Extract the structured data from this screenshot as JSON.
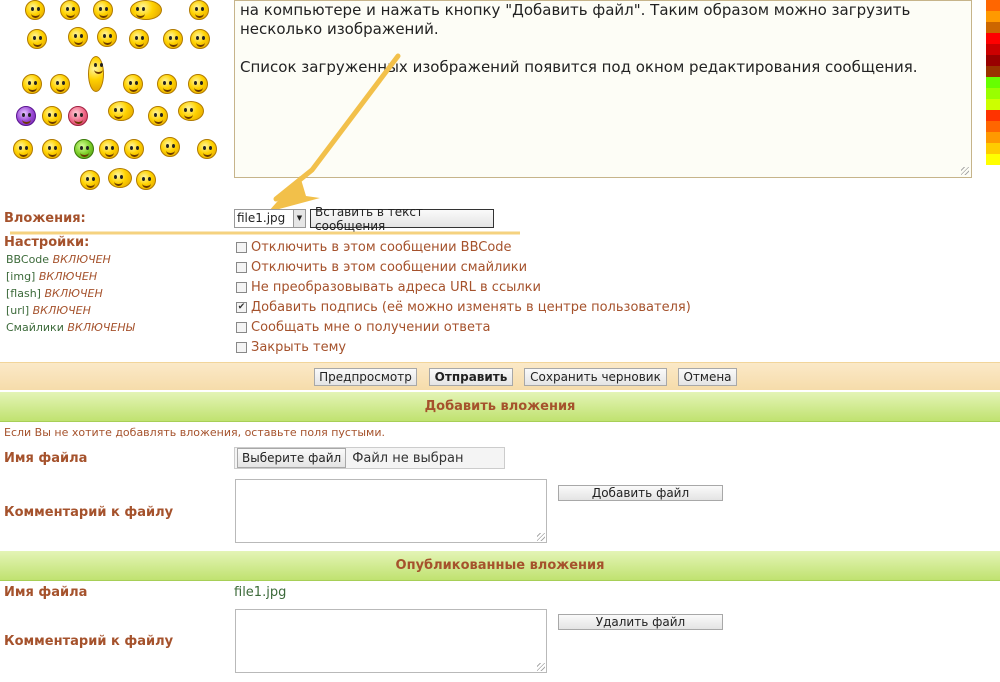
{
  "editor": {
    "lines": [
      "на компьютере и нажать кнопку \"Добавить файл\". Таким образом можно загрузить несколько изображений.",
      "Список загруженных изображений появится под окном редактирования сообщения."
    ]
  },
  "palette_colors": [
    "#ff6600",
    "#ff9900",
    "#cc6600",
    "#ff0000",
    "#cc0000",
    "#990000",
    "#993300",
    "#66ff00",
    "#99ff00",
    "#ccff00",
    "#ff3300",
    "#ff6600",
    "#ff9900",
    "#ffcc00",
    "#ffff00"
  ],
  "attachments": {
    "label": "Вложения:",
    "selected_file": "file1.jpg",
    "insert_button": "Вставить в текст сообщения"
  },
  "settings": {
    "label": "Настройки:",
    "items": [
      {
        "name": "BBCode",
        "state": "ВКЛЮЧЕН"
      },
      {
        "name": "[img]",
        "state": "ВКЛЮЧЕН"
      },
      {
        "name": "[flash]",
        "state": "ВКЛЮЧЕН"
      },
      {
        "name": "[url]",
        "state": "ВКЛЮЧЕН"
      },
      {
        "name": "Смайлики",
        "state": "ВКЛЮЧЕНЫ"
      }
    ],
    "options": [
      {
        "label": "Отключить в этом сообщении BBCode",
        "checked": false
      },
      {
        "label": "Отключить в этом сообщении смайлики",
        "checked": false
      },
      {
        "label": "Не преобразовывать адреса URL в ссылки",
        "checked": false
      },
      {
        "label": "Добавить подпись (её можно изменять в центре пользователя)",
        "checked": true
      },
      {
        "label": "Сообщать мне о получении ответа",
        "checked": false
      },
      {
        "label": "Закрыть тему",
        "checked": false
      }
    ]
  },
  "actions": {
    "preview": "Предпросмотр",
    "submit": "Отправить",
    "save_draft": "Сохранить черновик",
    "cancel": "Отмена"
  },
  "add_attachments": {
    "title": "Добавить вложения",
    "note": "Если Вы не хотите добавлять вложения, оставьте поля пустыми.",
    "filename_label": "Имя файла",
    "choose_button": "Выберите файл",
    "no_file": "Файл не выбран",
    "comment_label": "Комментарий к файлу",
    "add_button": "Добавить файл"
  },
  "published_attachments": {
    "title": "Опубликованные вложения",
    "filename_label": "Имя файла",
    "filename": "file1.jpg",
    "comment_label": "Комментарий к файлу",
    "delete_button": "Удалить файл"
  }
}
